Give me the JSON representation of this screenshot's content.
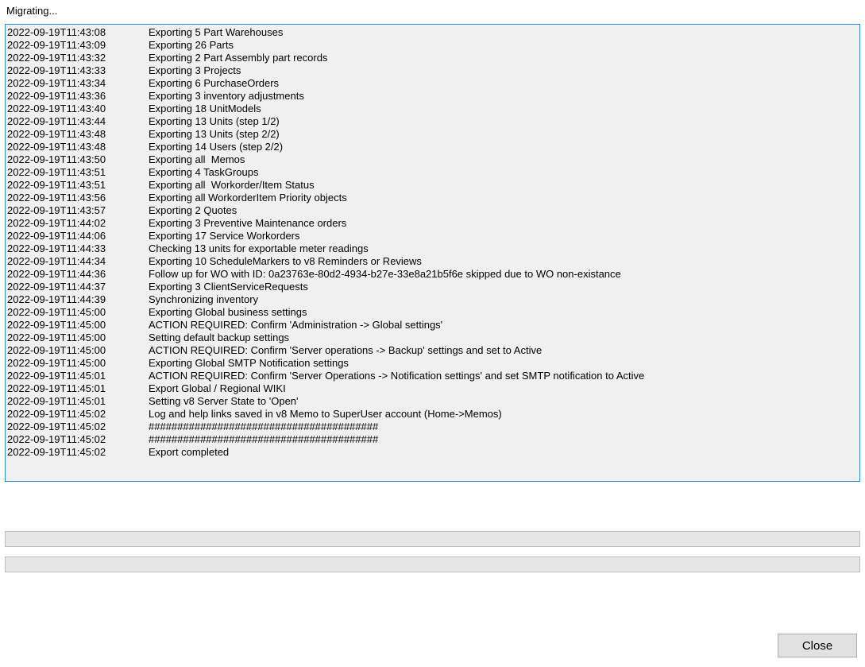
{
  "window": {
    "title": "Migrating..."
  },
  "log": [
    {
      "ts": "2022-09-19T11:43:08",
      "msg": "Exporting 5 Part Warehouses"
    },
    {
      "ts": "2022-09-19T11:43:09",
      "msg": "Exporting 26 Parts"
    },
    {
      "ts": "2022-09-19T11:43:32",
      "msg": "Exporting 2 Part Assembly part records"
    },
    {
      "ts": "2022-09-19T11:43:33",
      "msg": "Exporting 3 Projects"
    },
    {
      "ts": "2022-09-19T11:43:34",
      "msg": "Exporting 6 PurchaseOrders"
    },
    {
      "ts": "2022-09-19T11:43:36",
      "msg": "Exporting 3 inventory adjustments"
    },
    {
      "ts": "2022-09-19T11:43:40",
      "msg": "Exporting 18 UnitModels"
    },
    {
      "ts": "2022-09-19T11:43:44",
      "msg": "Exporting 13 Units (step 1/2)"
    },
    {
      "ts": "2022-09-19T11:43:48",
      "msg": "Exporting 13 Units (step 2/2)"
    },
    {
      "ts": "2022-09-19T11:43:48",
      "msg": "Exporting 14 Users (step 2/2)"
    },
    {
      "ts": "2022-09-19T11:43:50",
      "msg": "Exporting all  Memos"
    },
    {
      "ts": "2022-09-19T11:43:51",
      "msg": "Exporting 4 TaskGroups"
    },
    {
      "ts": "2022-09-19T11:43:51",
      "msg": "Exporting all  Workorder/Item Status"
    },
    {
      "ts": "2022-09-19T11:43:56",
      "msg": "Exporting all WorkorderItem Priority objects"
    },
    {
      "ts": "2022-09-19T11:43:57",
      "msg": "Exporting 2 Quotes"
    },
    {
      "ts": "2022-09-19T11:44:02",
      "msg": "Exporting 3 Preventive Maintenance orders"
    },
    {
      "ts": "2022-09-19T11:44:06",
      "msg": "Exporting 17 Service Workorders"
    },
    {
      "ts": "2022-09-19T11:44:33",
      "msg": "Checking 13 units for exportable meter readings"
    },
    {
      "ts": "2022-09-19T11:44:34",
      "msg": "Exporting 10 ScheduleMarkers to v8 Reminders or Reviews"
    },
    {
      "ts": "2022-09-19T11:44:36",
      "msg": "Follow up for WO with ID: 0a23763e-80d2-4934-b27e-33e8a21b5f6e skipped due to WO non-existance"
    },
    {
      "ts": "2022-09-19T11:44:37",
      "msg": "Exporting 3 ClientServiceRequests"
    },
    {
      "ts": "2022-09-19T11:44:39",
      "msg": "Synchronizing inventory"
    },
    {
      "ts": "2022-09-19T11:45:00",
      "msg": "Exporting Global business settings"
    },
    {
      "ts": "2022-09-19T11:45:00",
      "msg": "ACTION REQUIRED: Confirm 'Administration -> Global settings'"
    },
    {
      "ts": "2022-09-19T11:45:00",
      "msg": "Setting default backup settings"
    },
    {
      "ts": "2022-09-19T11:45:00",
      "msg": "ACTION REQUIRED: Confirm 'Server operations -> Backup' settings and set to Active"
    },
    {
      "ts": "2022-09-19T11:45:00",
      "msg": "Exporting Global SMTP Notification settings"
    },
    {
      "ts": "2022-09-19T11:45:01",
      "msg": "ACTION REQUIRED: Confirm 'Server Operations -> Notification settings' and set SMTP notification to Active"
    },
    {
      "ts": "2022-09-19T11:45:01",
      "msg": "Export Global / Regional WIKI"
    },
    {
      "ts": "2022-09-19T11:45:01",
      "msg": "Setting v8 Server State to 'Open'"
    },
    {
      "ts": "2022-09-19T11:45:02",
      "msg": "Log and help links saved in v8 Memo to SuperUser account (Home->Memos)"
    },
    {
      "ts": "2022-09-19T11:45:02",
      "msg": "########################################"
    },
    {
      "ts": "2022-09-19T11:45:02",
      "msg": "########################################"
    },
    {
      "ts": "2022-09-19T11:45:02",
      "msg": "Export completed"
    }
  ],
  "buttons": {
    "close": "Close"
  }
}
